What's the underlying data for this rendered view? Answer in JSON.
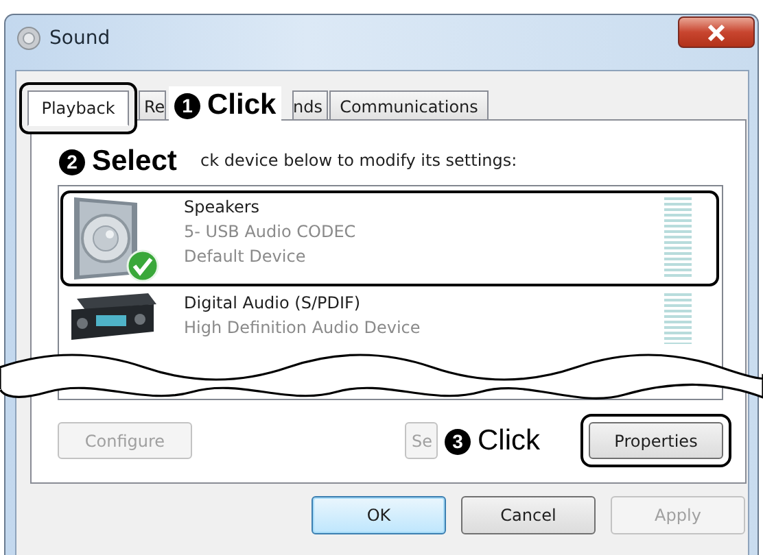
{
  "window": {
    "title": "Sound"
  },
  "tabs": [
    {
      "label": "Playback",
      "selected": true,
      "highlighted": true
    },
    {
      "label": "Re",
      "selected": false,
      "highlighted": false
    },
    {
      "label": "nds",
      "selected": false,
      "highlighted": false
    },
    {
      "label": "Communications",
      "selected": false,
      "highlighted": false
    }
  ],
  "instruction": "ck device below to modify its settings:",
  "devices": [
    {
      "kind": "speaker",
      "name": "Speakers",
      "lines": [
        "5- USB Audio CODEC",
        "Default Device"
      ],
      "default": true,
      "selected": true
    },
    {
      "kind": "receiver",
      "name": "Digital Audio (S/PDIF)",
      "lines": [
        "High Definition Audio Device"
      ],
      "default": false,
      "selected": false
    }
  ],
  "panel_buttons": [
    {
      "label": "Configure",
      "disabled": true,
      "highlighted": false
    },
    {
      "label": "Se",
      "disabled": true,
      "highlighted": false
    },
    {
      "label": "Properties",
      "disabled": false,
      "highlighted": true
    }
  ],
  "dialog_buttons": [
    {
      "label": "OK",
      "default": true,
      "disabled": false
    },
    {
      "label": "Cancel",
      "default": false,
      "disabled": false
    },
    {
      "label": "Apply",
      "default": false,
      "disabled": true
    }
  ],
  "callouts": [
    {
      "number": "1",
      "text": "Click",
      "bold": true
    },
    {
      "number": "2",
      "text": "Select",
      "bold": true
    },
    {
      "number": "3",
      "text": "Click",
      "bold": false
    }
  ]
}
